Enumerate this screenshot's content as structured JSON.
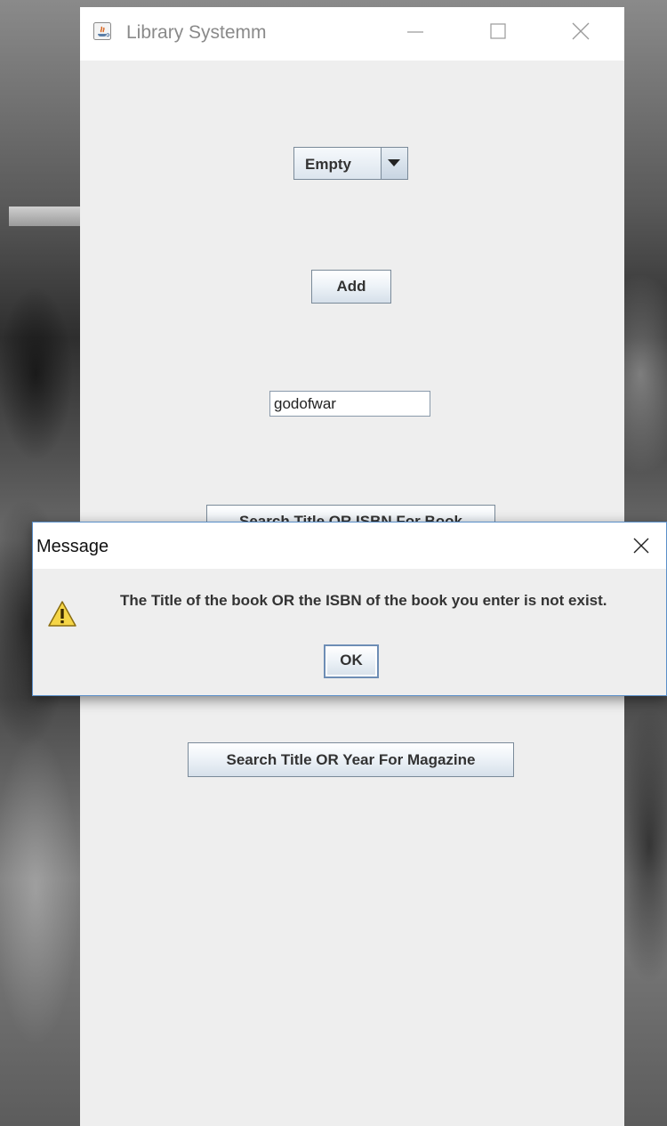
{
  "window": {
    "title": "Library Systemm",
    "icon": "java-icon",
    "controls": [
      "minimize-icon",
      "maximize-icon",
      "close-icon"
    ]
  },
  "form": {
    "combo_value": "Empty",
    "add_label": "Add",
    "search_value": "godofwar",
    "search_book_label": "Search Title OR ISBN For Book",
    "search_magazine_label": "Search Title OR Year For Magazine"
  },
  "dialog": {
    "title": "Message",
    "icon": "warning-icon",
    "message": "The Title of the book OR the ISBN of the book you enter is not exist.",
    "ok_label": "OK"
  },
  "colors": {
    "window_background": "#eeeeee",
    "titlebar": "#ffffff",
    "button_border": "#7a8a99",
    "dialog_border": "#5a8fc9",
    "warning_fill": "#f5d547"
  }
}
